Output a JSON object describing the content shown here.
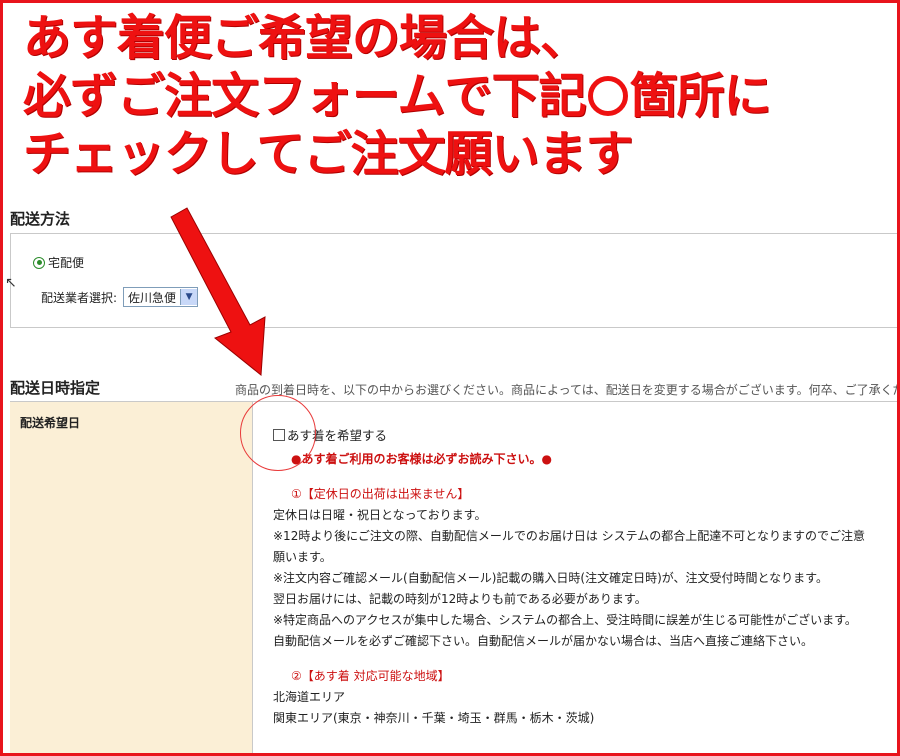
{
  "headline": {
    "line1": "あす着便ご希望の場合は、",
    "line2_prefix": "必ずご注文フォームで下記",
    "line2_suffix": "箇所に",
    "line3": "チェックしてご注文願います"
  },
  "shipping": {
    "title": "配送方法",
    "method_label": "宅配便",
    "carrier_label": "配送業者選択:",
    "carrier_value": "佐川急便"
  },
  "date": {
    "title": "配送日時指定",
    "notice": "商品の到着日時を、以下の中からお選びください。商品によっては、配送日を変更する場合がございます。何卒、ご了承くださ",
    "row_label": "配送希望日",
    "checkbox_label": "あす着を希望する",
    "must_read": "●あす着ご利用のお客様は必ずお読み下さい。●",
    "sec1_title": "①【定休日の出荷は出来ません】",
    "sec1_lines": [
      "定休日は日曜・祝日となっております。",
      "※12時より後にご注文の際、自動配信メールでのお届け日は システムの都合上配達不可となりますのでご注意",
      "願います。",
      "※注文内容ご確認メール(自動配信メール)記載の購入日時(注文確定日時)が、注文受付時間となります。",
      "翌日お届けには、記載の時刻が12時よりも前である必要があります。",
      "※特定商品へのアクセスが集中した場合、システムの都合上、受注時間に誤差が生じる可能性がございます。",
      "自動配信メールを必ずご確認下さい。自動配信メールが届かない場合は、当店へ直接ご連絡下さい。"
    ],
    "sec2_title": "②【あす着 対応可能な地域】",
    "sec2_lines": [
      "北海道エリア",
      "関東エリア(東京・神奈川・千葉・埼玉・群馬・栃木・茨城)"
    ]
  },
  "colors": {
    "headline_red": "#ee1111",
    "label_bg": "#fbefd6"
  }
}
